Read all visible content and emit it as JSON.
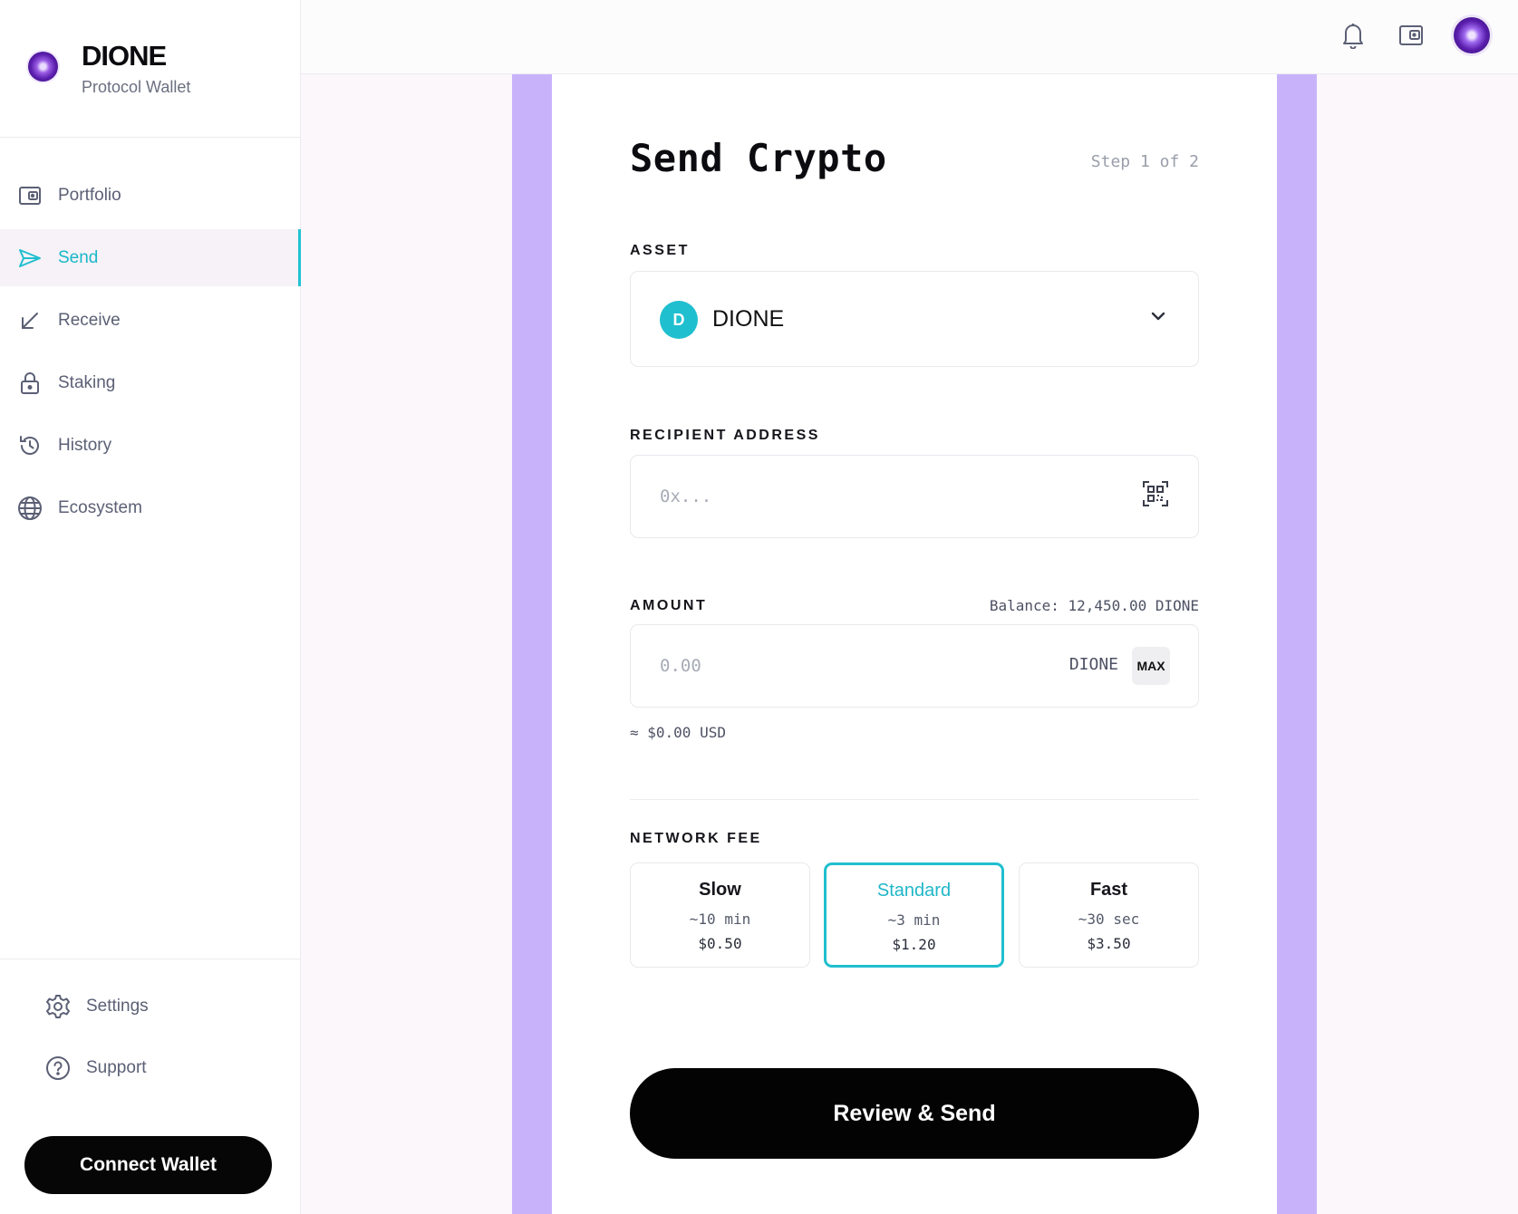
{
  "brand": {
    "name": "DIONE",
    "subtitle": "Protocol Wallet"
  },
  "sidebar": {
    "items": [
      {
        "label": "Portfolio",
        "icon": "wallet-icon",
        "active": false
      },
      {
        "label": "Send",
        "icon": "send-icon",
        "active": true
      },
      {
        "label": "Receive",
        "icon": "receive-arrow-icon",
        "active": false
      },
      {
        "label": "Staking",
        "icon": "lock-icon",
        "active": false
      },
      {
        "label": "History",
        "icon": "history-icon",
        "active": false
      },
      {
        "label": "Ecosystem",
        "icon": "globe-icon",
        "active": false
      }
    ],
    "bottom": [
      {
        "label": "Settings",
        "icon": "gear-icon"
      },
      {
        "label": "Support",
        "icon": "help-icon"
      }
    ],
    "connect_label": "Connect Wallet"
  },
  "topbar": {
    "icons": [
      "bell-icon",
      "wallet-icon",
      "avatar"
    ]
  },
  "form": {
    "title": "Send Crypto",
    "step": "Step 1 of 2",
    "asset": {
      "label": "ASSET",
      "coin_letter": "D",
      "value": "DIONE"
    },
    "recipient": {
      "label": "RECIPIENT ADDRESS",
      "placeholder": "0x..."
    },
    "amount": {
      "label": "AMOUNT",
      "balance": "Balance: 12,450.00 DIONE",
      "placeholder": "0.00",
      "unit": "DIONE",
      "max_label": "MAX",
      "usd": "≈ $0.00 USD"
    },
    "fee": {
      "label": "NETWORK FEE",
      "options": [
        {
          "name": "Slow",
          "time": "~10 min",
          "cost": "$0.50",
          "selected": false
        },
        {
          "name": "Standard",
          "time": "~3 min",
          "cost": "$1.20",
          "selected": true
        },
        {
          "name": "Fast",
          "time": "~30 sec",
          "cost": "$3.50",
          "selected": false
        }
      ]
    },
    "submit_label": "Review & Send"
  },
  "colors": {
    "accent": "#1fbfcf",
    "stripe": "#c8b3fb",
    "button": "#030303"
  }
}
